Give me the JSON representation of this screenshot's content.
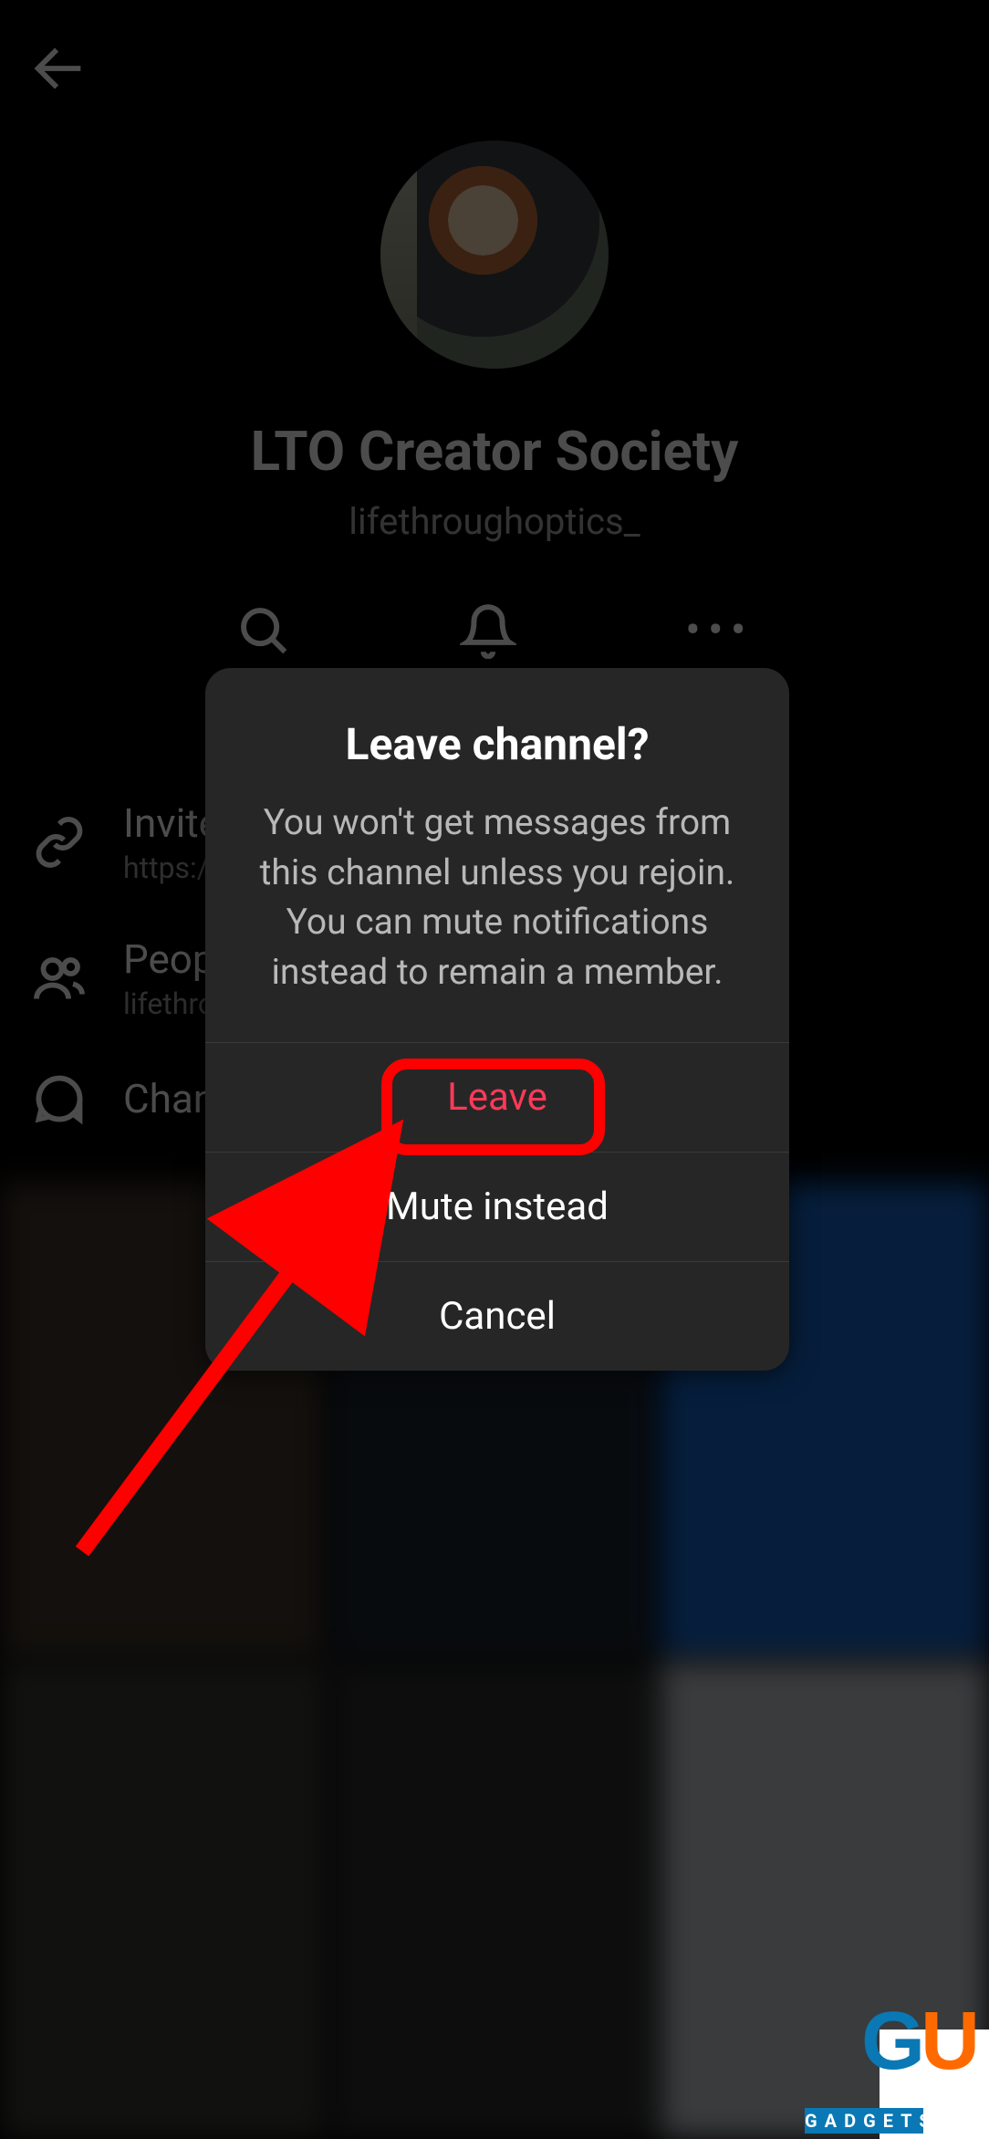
{
  "channel": {
    "title": "LTO Creator Society",
    "subtitle": "lifethroughoptics_"
  },
  "actions": {
    "search": "Search",
    "mute": "Mute",
    "options": "Options"
  },
  "rows": {
    "invite": {
      "title": "Invite",
      "sub": "https://"
    },
    "people": {
      "title": "Peop",
      "sub": "lifethro"
    },
    "channel": {
      "title": "Chan"
    }
  },
  "modal": {
    "title": "Leave channel?",
    "body": "You won't get messages from this channel unless you rejoin. You can mute notifications instead to remain a member.",
    "leave": "Leave",
    "mute": "Mute instead",
    "cancel": "Cancel"
  },
  "watermark": {
    "g": "G",
    "u": "U",
    "label": "GADGETS"
  }
}
